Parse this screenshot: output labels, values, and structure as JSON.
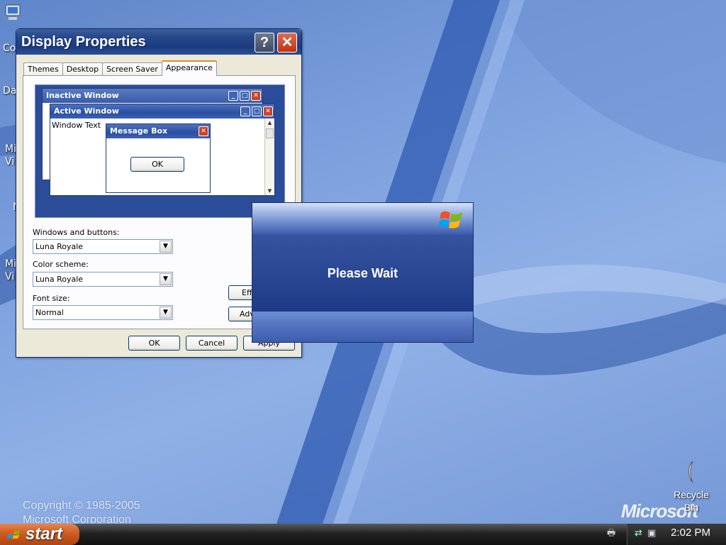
{
  "desktop": {
    "icons": [
      {
        "label": "Co"
      },
      {
        "label": "Da"
      },
      {
        "label": "Mi Vi"
      },
      {
        "label": "M"
      },
      {
        "label": "Mi Vi"
      }
    ],
    "copyright_line1": "Copyright © 1985-2005",
    "copyright_line2": "Microsoft Corporation",
    "brand": "Microsoft",
    "recycle_bin_label": "Recycle Bin"
  },
  "window": {
    "title": "Display Properties",
    "help_glyph": "?",
    "close_glyph": "✕",
    "tabs": [
      {
        "label": "Themes"
      },
      {
        "label": "Desktop"
      },
      {
        "label": "Screen Saver"
      },
      {
        "label": "Appearance",
        "active": true
      }
    ],
    "preview": {
      "inactive_title": "Inactive Window",
      "active_title": "Active Window",
      "window_text": "Window Text",
      "message_box_title": "Message Box",
      "message_box_ok": "OK"
    },
    "windows_buttons_label": "Windows and buttons:",
    "windows_buttons_value": "Luna Royale",
    "color_scheme_label": "Color scheme:",
    "color_scheme_value": "Luna Royale",
    "font_size_label": "Font size:",
    "font_size_value": "Normal",
    "effects_label": "Effe",
    "advanced_label": "Adv",
    "ok_label": "OK",
    "cancel_label": "Cancel",
    "apply_label": "Apply"
  },
  "wait_dialog": {
    "message": "Please Wait"
  },
  "taskbar": {
    "start_label": "start",
    "clock": "2:02 PM"
  },
  "colors": {
    "titlebar": "#1c3c80",
    "accent_tab": "#e68b2c",
    "start_button": "#c85a1f",
    "wait_body": "#2a4794"
  }
}
